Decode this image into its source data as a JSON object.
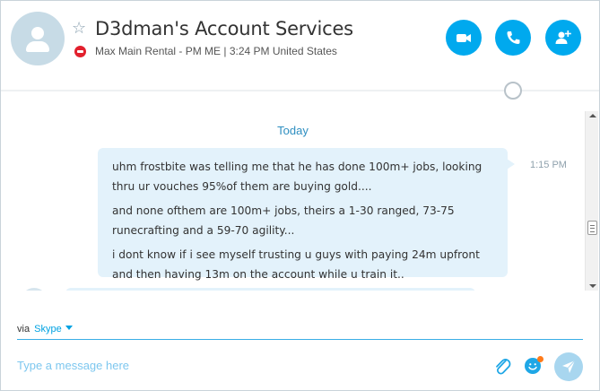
{
  "header": {
    "contact_name": "D3dman's Account Services",
    "status_text": "Max Main Rental  - PM ME  |  3:24 PM United States",
    "favorite_icon": "star-outline-icon",
    "presence_icon": "do-not-disturb-icon",
    "buttons": {
      "video_call": "video-call-icon",
      "audio_call": "phone-icon",
      "add_people": "add-person-icon"
    },
    "accent_color": "#00a9ee"
  },
  "conversation": {
    "day_label": "Today",
    "messages": [
      {
        "time": "1:15 PM",
        "paragraphs": [
          "uhm frostbite was telling me that he has done 100m+ jobs, looking thru ur vouches 95%of them are buying gold....",
          "and none ofthem are 100m+ jobs, theirs a 1-30 ranged, 73-75 runecrafting and a 59-70 agility...",
          "i dont know if i see myself trusting u guys with paying 24m upfront and then having 13m on the account while u train it.."
        ]
      }
    ],
    "bubble_color": "#e3f2fb"
  },
  "composer": {
    "via_label": "via",
    "via_service": "Skype",
    "placeholder": "Type a message here",
    "value": "",
    "attach_icon": "paperclip-icon",
    "emoji_icon": "emoticon-icon",
    "send_icon": "send-icon"
  }
}
